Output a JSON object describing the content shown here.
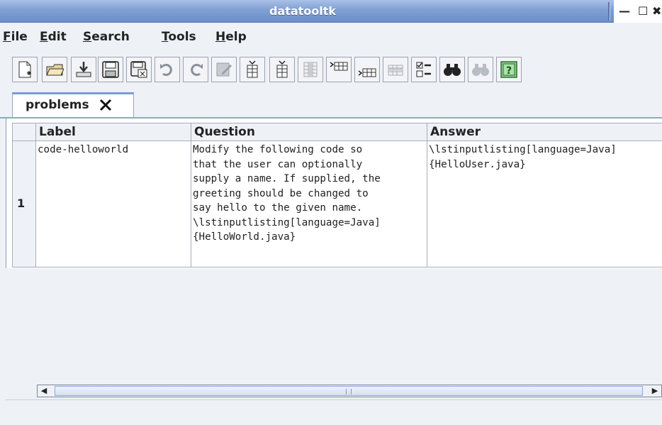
{
  "window": {
    "title": "datatooltk",
    "min": "—",
    "max": "☐",
    "close": "✖"
  },
  "menu": [
    {
      "key": "F",
      "rest": "ile"
    },
    {
      "key": "E",
      "rest": "dit"
    },
    {
      "key": "S",
      "rest": "earch"
    },
    {
      "key": "T",
      "rest": "ools"
    },
    {
      "key": "H",
      "rest": "elp"
    }
  ],
  "toolbar": [
    "new-file-icon",
    "open-folder-icon",
    "import-icon",
    "save-icon",
    "save-as-icon",
    "undo-icon",
    "redo-icon",
    "edit-cell-icon",
    "insert-column-before-icon",
    "insert-column-after-icon",
    "remove-column-icon",
    "insert-row-before-icon",
    "insert-row-after-icon",
    "remove-row-icon",
    "properties-icon",
    "find-icon",
    "find-again-icon",
    "help-icon"
  ],
  "tab": {
    "label": "problems"
  },
  "table": {
    "columns": [
      "Label",
      "Question",
      "Answer"
    ],
    "rows": [
      {
        "index": "1",
        "label": "code-helloworld",
        "question": "Modify the following code so\nthat the user can optionally\nsupply a name. If supplied, the\ngreeting should be changed to\nsay hello to the given name.\n\\lstinputlisting[language=Java]\n{HelloWorld.java}",
        "answer": "\\lstinputlisting[language=Java]\n{HelloUser.java}"
      }
    ]
  },
  "scrollbar": {
    "left": "◀",
    "right": "▶"
  }
}
